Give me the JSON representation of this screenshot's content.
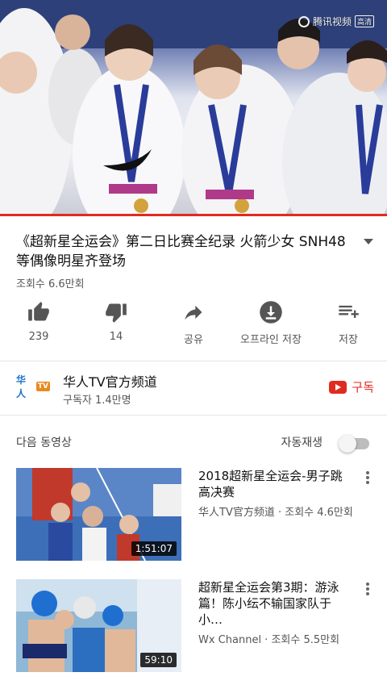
{
  "player": {
    "watermark": "腾讯视频",
    "watermark_badge": "高清"
  },
  "video": {
    "title": "《超新星全运会》第二日比赛全纪录 火箭少女 SNH48 等偶像明星齐登场",
    "views": "조회수 6.6만회"
  },
  "actions": [
    {
      "icon": "thumbs-up-icon",
      "label": "239"
    },
    {
      "icon": "thumbs-down-icon",
      "label": "14"
    },
    {
      "icon": "share-icon",
      "label": "공유"
    },
    {
      "icon": "download-icon",
      "label": "오프라인 저장"
    },
    {
      "icon": "add-to-playlist-icon",
      "label": "저장"
    }
  ],
  "channel": {
    "logo_text": "华人",
    "logo_badge": "TV",
    "name": "华人TV官方频道",
    "subscribers": "구독자 1.4만명",
    "subscribe_label": "구독"
  },
  "up_next": {
    "label": "다음 동영상",
    "autoplay_label": "자동재생",
    "autoplay_on": false
  },
  "videos": [
    {
      "title": "2018超新星全运会-男子跳高决赛",
      "meta": "华人TV官方频道 · 조회수 4.6만회",
      "duration": "1:51:07"
    },
    {
      "title": "超新星全运会第3期：游泳篇！陈小纭不输国家队于小…",
      "meta": "Wx Channel · 조회수 5.5만회",
      "duration": "59:10"
    }
  ],
  "colors": {
    "accent": "#e02b20",
    "secondary_text": "#555555"
  }
}
